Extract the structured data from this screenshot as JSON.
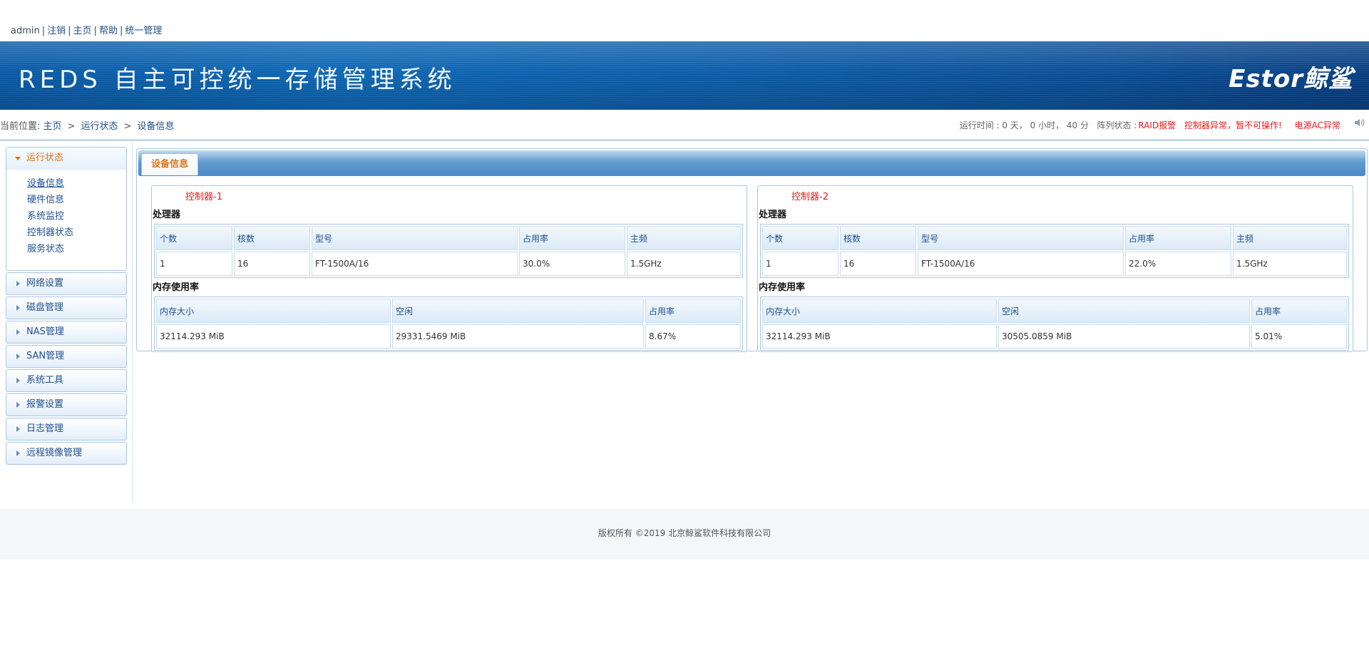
{
  "top_links": {
    "user": "admin",
    "logout": "注销",
    "home": "主页",
    "help": "帮助",
    "unified": "统一管理"
  },
  "banner": {
    "title": "REDS 自主可控统一存储管理系统",
    "logo": "Estor鲸鲨"
  },
  "breadcrumb": {
    "prefix": "当前位置:",
    "home": "主页",
    "level1": "运行状态",
    "level2": "设备信息"
  },
  "runinfo": {
    "runtime": "运行时间 : 0 天， 0 小时， 40 分",
    "array_label": "阵列状态 :",
    "raid_alarm": "RAID报警",
    "controller_alarm": "控制器异常，暂不可操作!",
    "power_alarm": "电源AC异常"
  },
  "sidebar": {
    "open_menu": "运行状态",
    "sub_items": [
      "设备信息",
      "硬件信息",
      "系统监控",
      "控制器状态",
      "服务状态"
    ],
    "items": [
      "网络设置",
      "磁盘管理",
      "NAS管理",
      "SAN管理",
      "系统工具",
      "报警设置",
      "日志管理",
      "远程镜像管理"
    ]
  },
  "main": {
    "tab": "设备信息",
    "cpu_section": "处理器",
    "mem_section": "内存使用率",
    "cpu_headers": [
      "个数",
      "核数",
      "型号",
      "占用率",
      "主频"
    ],
    "mem_headers": [
      "内存大小",
      "空闲",
      "占用率"
    ],
    "controllers": [
      {
        "title": "控制器-1",
        "cpu": [
          "1",
          "16",
          "FT-1500A/16",
          "30.0%",
          "1.5GHz"
        ],
        "mem": [
          "32114.293 MiB",
          "29331.5469 MiB",
          "8.67%"
        ]
      },
      {
        "title": "控制器-2",
        "cpu": [
          "1",
          "16",
          "FT-1500A/16",
          "22.0%",
          "1.5GHz"
        ],
        "mem": [
          "32114.293 MiB",
          "30505.0859 MiB",
          "5.01%"
        ]
      }
    ]
  },
  "footer": {
    "copyright": "版权所有 ©2019 北京鲸鲨软件科技有限公司"
  }
}
